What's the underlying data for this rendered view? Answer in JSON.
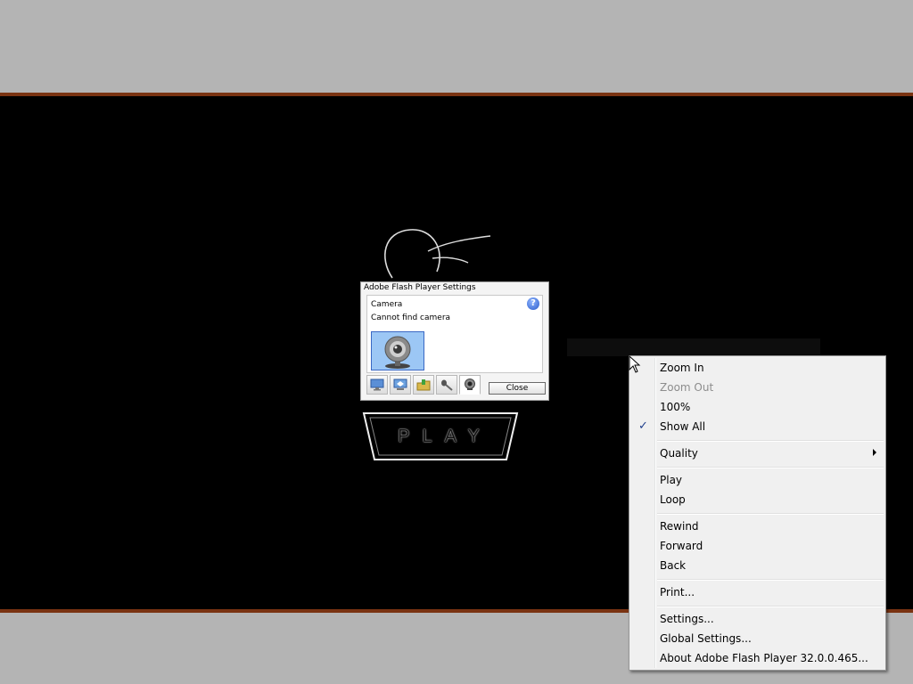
{
  "flash_dialog": {
    "title": "Adobe Flash Player Settings",
    "heading": "Camera",
    "message": "Cannot find camera",
    "help_icon": "help-icon",
    "help_glyph": "?",
    "close_label": "Close",
    "tabs": [
      {
        "name": "privacy",
        "icon": "display-icon"
      },
      {
        "name": "local-storage",
        "icon": "storage-icon"
      },
      {
        "name": "microphone-folder",
        "icon": "folder-icon"
      },
      {
        "name": "microphone",
        "icon": "microphone-icon"
      },
      {
        "name": "camera",
        "icon": "webcam-icon",
        "active": true
      }
    ]
  },
  "game": {
    "play_label": "PLAY"
  },
  "context_menu": {
    "items": [
      {
        "label": "Zoom In",
        "enabled": true
      },
      {
        "label": "Zoom Out",
        "enabled": false
      },
      {
        "label": "100%",
        "enabled": true
      },
      {
        "label": "Show All",
        "enabled": true,
        "checked": true
      },
      {
        "label": "Quality",
        "enabled": true,
        "submenu": true
      },
      {
        "label": "Play",
        "enabled": true
      },
      {
        "label": "Loop",
        "enabled": true
      },
      {
        "label": "Rewind",
        "enabled": true
      },
      {
        "label": "Forward",
        "enabled": true
      },
      {
        "label": "Back",
        "enabled": true
      },
      {
        "label": "Print...",
        "enabled": true
      },
      {
        "label": "Settings...",
        "enabled": true
      },
      {
        "label": "Global Settings...",
        "enabled": true
      },
      {
        "label": "About Adobe Flash Player 32.0.0.465...",
        "enabled": true
      }
    ]
  },
  "colors": {
    "stage_background": "#000000",
    "page_background": "#b4b4b4",
    "stage_border": "#7a3312",
    "camera_highlight": "#9cc7f5",
    "check_mark": "#1f3f8c"
  }
}
